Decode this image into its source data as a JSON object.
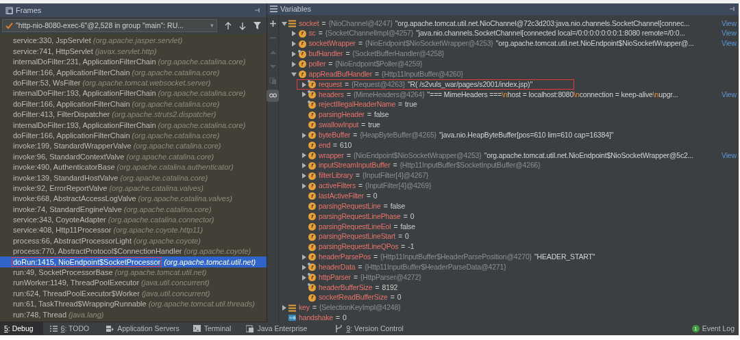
{
  "frames_panel": {
    "title": "Frames",
    "thread_selector": {
      "value": "\"http-nio-8080-exec-6\"@2,528 in group \"main\": RU...",
      "caret": "▾"
    },
    "frames": [
      {
        "method": "service:330, JspServlet",
        "package": "(org.apache.jasper.servlet)",
        "selected": false,
        "boxed": false
      },
      {
        "method": "service:741, HttpServlet",
        "package": "(javax.servlet.http)",
        "selected": false,
        "boxed": false
      },
      {
        "method": "internalDoFilter:231, ApplicationFilterChain",
        "package": "(org.apache.catalina.core)",
        "selected": false,
        "boxed": false
      },
      {
        "method": "doFilter:166, ApplicationFilterChain",
        "package": "(org.apache.catalina.core)",
        "selected": false,
        "boxed": false
      },
      {
        "method": "doFilter:53, WsFilter",
        "package": "(org.apache.tomcat.websocket.server)",
        "selected": false,
        "boxed": false
      },
      {
        "method": "internalDoFilter:193, ApplicationFilterChain",
        "package": "(org.apache.catalina.core)",
        "selected": false,
        "boxed": false
      },
      {
        "method": "doFilter:166, ApplicationFilterChain",
        "package": "(org.apache.catalina.core)",
        "selected": false,
        "boxed": false
      },
      {
        "method": "doFilter:413, FilterDispatcher",
        "package": "(org.apache.struts2.dispatcher)",
        "selected": false,
        "boxed": false
      },
      {
        "method": "internalDoFilter:193, ApplicationFilterChain",
        "package": "(org.apache.catalina.core)",
        "selected": false,
        "boxed": false
      },
      {
        "method": "doFilter:166, ApplicationFilterChain",
        "package": "(org.apache.catalina.core)",
        "selected": false,
        "boxed": false
      },
      {
        "method": "invoke:199, StandardWrapperValve",
        "package": "(org.apache.catalina.core)",
        "selected": false,
        "boxed": false
      },
      {
        "method": "invoke:96, StandardContextValve",
        "package": "(org.apache.catalina.core)",
        "selected": false,
        "boxed": false
      },
      {
        "method": "invoke:490, AuthenticatorBase",
        "package": "(org.apache.catalina.authenticator)",
        "selected": false,
        "boxed": false
      },
      {
        "method": "invoke:139, StandardHostValve",
        "package": "(org.apache.catalina.core)",
        "selected": false,
        "boxed": false
      },
      {
        "method": "invoke:92, ErrorReportValve",
        "package": "(org.apache.catalina.valves)",
        "selected": false,
        "boxed": false
      },
      {
        "method": "invoke:668, AbstractAccessLogValve",
        "package": "(org.apache.catalina.valves)",
        "selected": false,
        "boxed": false
      },
      {
        "method": "invoke:74, StandardEngineValve",
        "package": "(org.apache.catalina.core)",
        "selected": false,
        "boxed": false
      },
      {
        "method": "service:343, CoyoteAdapter",
        "package": "(org.apache.catalina.connector)",
        "selected": false,
        "boxed": false
      },
      {
        "method": "service:408, Http11Processor",
        "package": "(org.apache.coyote.http11)",
        "selected": false,
        "boxed": false
      },
      {
        "method": "process:66, AbstractProcessorLight",
        "package": "(org.apache.coyote)",
        "selected": false,
        "boxed": false
      },
      {
        "method": "process:770, AbstractProtocol$ConnectionHandler",
        "package": "(org.apache.coyote)",
        "selected": false,
        "boxed": false
      },
      {
        "method": "doRun:1415, NioEndpoint$SocketProcessor",
        "package": "(org.apache.tomcat.util.net)",
        "selected": true,
        "boxed": true
      },
      {
        "method": "run:49, SocketProcessorBase",
        "package": "(org.apache.tomcat.util.net)",
        "selected": false,
        "boxed": false
      },
      {
        "method": "runWorker:1149, ThreadPoolExecutor",
        "package": "(java.util.concurrent)",
        "selected": false,
        "boxed": false
      },
      {
        "method": "run:624, ThreadPoolExecutor$Worker",
        "package": "(java.util.concurrent)",
        "selected": false,
        "boxed": false
      },
      {
        "method": "run:61, TaskThread$WrappingRunnable",
        "package": "(org.apache.tomcat.util.threads)",
        "selected": false,
        "boxed": false
      },
      {
        "method": "run:748, Thread",
        "package": "(java.lang)",
        "selected": false,
        "boxed": false
      }
    ]
  },
  "variables_panel": {
    "title": "Variables",
    "toolbar": [
      {
        "kind": "add",
        "disabled": false,
        "selected": false
      },
      {
        "kind": "remove",
        "disabled": true,
        "selected": false
      },
      {
        "kind": "up",
        "disabled": true,
        "selected": false
      },
      {
        "kind": "down",
        "disabled": true,
        "selected": false
      },
      {
        "kind": "copy",
        "disabled": true,
        "selected": false
      },
      {
        "kind": "watches",
        "disabled": false,
        "selected": true
      }
    ],
    "tree": [
      {
        "kind": "object",
        "name": "socket",
        "expanded": true,
        "value": [
          {
            "kind": "plain",
            "text": "="
          },
          {
            "kind": "type",
            "text": "{NioChannel@4247}"
          },
          {
            "kind": "string",
            "text": "\"org.apache.tomcat.util.net.NioChannel@72c3d203:java.nio.channels.SocketChannel[connec..."
          }
        ],
        "link": "View",
        "children": [
          {
            "kind": "field",
            "icon": "f",
            "marker": false,
            "name": "sc",
            "expanded": false,
            "value": [
              {
                "kind": "plain",
                "text": "="
              },
              {
                "kind": "type",
                "text": "{SocketChannelImpl@4257}"
              },
              {
                "kind": "string",
                "text": "\"java.nio.channels.SocketChannel[connected local=/0:0:0:0:0:0:0:1:8080 remote=/0:0..."
              }
            ],
            "link": "View"
          },
          {
            "kind": "field",
            "icon": "f",
            "marker": false,
            "name": "socketWrapper",
            "expanded": false,
            "value": [
              {
                "kind": "plain",
                "text": "="
              },
              {
                "kind": "type",
                "text": "{NioEndpoint$NioSocketWrapper@4253}"
              },
              {
                "kind": "string",
                "text": "\"org.apache.tomcat.util.net.NioEndpoint$NioSocketWrapper@..."
              }
            ],
            "link": "View"
          },
          {
            "kind": "field",
            "icon": "f",
            "marker": true,
            "name": "bufHandler",
            "expanded": false,
            "value": [
              {
                "kind": "plain",
                "text": "="
              },
              {
                "kind": "type",
                "text": "{SocketBufferHandler@4258}"
              }
            ]
          },
          {
            "kind": "field",
            "icon": "f",
            "marker": false,
            "name": "poller",
            "expanded": false,
            "value": [
              {
                "kind": "plain",
                "text": "="
              },
              {
                "kind": "type",
                "text": "{NioEndpoint$Poller@4259}"
              }
            ]
          },
          {
            "kind": "field",
            "icon": "f",
            "marker": false,
            "name": "appReadBufHandler",
            "expanded": true,
            "value": [
              {
                "kind": "plain",
                "text": "="
              },
              {
                "kind": "type",
                "text": "{Http11InputBuffer@4260}"
              }
            ],
            "children": [
              {
                "kind": "field",
                "icon": "f",
                "marker": true,
                "name": "request",
                "expanded": false,
                "boxed": true,
                "value": [
                  {
                    "kind": "plain",
                    "text": "="
                  },
                  {
                    "kind": "type",
                    "text": "{Request@4263}"
                  },
                  {
                    "kind": "string",
                    "text": "\"R( /s2vuls_war/pages/s2001/index.jsp)\""
                  }
                ]
              },
              {
                "kind": "field",
                "icon": "f",
                "marker": true,
                "name": "headers",
                "expanded": false,
                "value": [
                  {
                    "kind": "plain",
                    "text": "="
                  },
                  {
                    "kind": "type",
                    "text": "{MimeHeaders@4264}"
                  },
                  {
                    "kind": "string",
                    "text": "\"=== MimeHeaders ==="
                  },
                  {
                    "kind": "escape",
                    "text": "\\n"
                  },
                  {
                    "kind": "string",
                    "text": "host = localhost:8080"
                  },
                  {
                    "kind": "escape",
                    "text": "\\n"
                  },
                  {
                    "kind": "string",
                    "text": "connection = keep-alive"
                  },
                  {
                    "kind": "escape",
                    "text": "\\n"
                  },
                  {
                    "kind": "string",
                    "text": "upgr..."
                  }
                ],
                "link": "View"
              },
              {
                "kind": "field",
                "icon": "f",
                "marker": true,
                "name": "rejectIllegalHeaderName",
                "value": [
                  {
                    "kind": "plain",
                    "text": "="
                  },
                  {
                    "kind": "plain",
                    "text": "true"
                  }
                ]
              },
              {
                "kind": "field",
                "icon": "f",
                "marker": false,
                "name": "parsingHeader",
                "value": [
                  {
                    "kind": "plain",
                    "text": "="
                  },
                  {
                    "kind": "plain",
                    "text": "false"
                  }
                ]
              },
              {
                "kind": "field",
                "icon": "f",
                "marker": false,
                "name": "swallowInput",
                "value": [
                  {
                    "kind": "plain",
                    "text": "="
                  },
                  {
                    "kind": "plain",
                    "text": "true"
                  }
                ]
              },
              {
                "kind": "field",
                "icon": "f",
                "marker": false,
                "name": "byteBuffer",
                "expanded": false,
                "value": [
                  {
                    "kind": "plain",
                    "text": "="
                  },
                  {
                    "kind": "type",
                    "text": "{HeapByteBuffer@4265}"
                  },
                  {
                    "kind": "string",
                    "text": "\"java.nio.HeapByteBuffer[pos=610 lim=610 cap=16384]\""
                  }
                ]
              },
              {
                "kind": "field",
                "icon": "f",
                "marker": false,
                "name": "end",
                "value": [
                  {
                    "kind": "plain",
                    "text": "="
                  },
                  {
                    "kind": "plain",
                    "text": "610"
                  }
                ]
              },
              {
                "kind": "field",
                "icon": "f",
                "marker": false,
                "name": "wrapper",
                "expanded": false,
                "value": [
                  {
                    "kind": "plain",
                    "text": "="
                  },
                  {
                    "kind": "type",
                    "text": "{NioEndpoint$NioSocketWrapper@4253}"
                  },
                  {
                    "kind": "string",
                    "text": "\"org.apache.tomcat.util.net.NioEndpoint$NioSocketWrapper@5c2..."
                  }
                ],
                "link": "View"
              },
              {
                "kind": "field",
                "icon": "f",
                "marker": false,
                "name": "inputStreamInputBuffer",
                "expanded": false,
                "value": [
                  {
                    "kind": "plain",
                    "text": "="
                  },
                  {
                    "kind": "type",
                    "text": "{Http11InputBuffer$SocketInputBuffer@4266}"
                  }
                ]
              },
              {
                "kind": "field",
                "icon": "f",
                "marker": false,
                "name": "filterLibrary",
                "expanded": false,
                "value": [
                  {
                    "kind": "plain",
                    "text": "="
                  },
                  {
                    "kind": "type",
                    "text": "{InputFilter[4]@4267}"
                  }
                ]
              },
              {
                "kind": "field",
                "icon": "f",
                "marker": false,
                "name": "activeFilters",
                "expanded": false,
                "value": [
                  {
                    "kind": "plain",
                    "text": "="
                  },
                  {
                    "kind": "type",
                    "text": "{InputFilter[4]@4269}"
                  }
                ]
              },
              {
                "kind": "field",
                "icon": "f",
                "marker": false,
                "name": "lastActiveFilter",
                "value": [
                  {
                    "kind": "plain",
                    "text": "="
                  },
                  {
                    "kind": "plain",
                    "text": "0"
                  }
                ]
              },
              {
                "kind": "field",
                "icon": "f",
                "marker": false,
                "name": "parsingRequestLine",
                "value": [
                  {
                    "kind": "plain",
                    "text": "="
                  },
                  {
                    "kind": "plain",
                    "text": "false"
                  }
                ]
              },
              {
                "kind": "field",
                "icon": "f",
                "marker": false,
                "name": "parsingRequestLinePhase",
                "value": [
                  {
                    "kind": "plain",
                    "text": "="
                  },
                  {
                    "kind": "plain",
                    "text": "0"
                  }
                ]
              },
              {
                "kind": "field",
                "icon": "f",
                "marker": false,
                "name": "parsingRequestLineEol",
                "value": [
                  {
                    "kind": "plain",
                    "text": "="
                  },
                  {
                    "kind": "plain",
                    "text": "false"
                  }
                ]
              },
              {
                "kind": "field",
                "icon": "f",
                "marker": false,
                "name": "parsingRequestLineStart",
                "value": [
                  {
                    "kind": "plain",
                    "text": "="
                  },
                  {
                    "kind": "plain",
                    "text": "0"
                  }
                ]
              },
              {
                "kind": "field",
                "icon": "f",
                "marker": false,
                "name": "parsingRequestLineQPos",
                "value": [
                  {
                    "kind": "plain",
                    "text": "="
                  },
                  {
                    "kind": "plain",
                    "text": "-1"
                  }
                ]
              },
              {
                "kind": "field",
                "icon": "f",
                "marker": false,
                "name": "headerParsePos",
                "expanded": false,
                "value": [
                  {
                    "kind": "plain",
                    "text": "="
                  },
                  {
                    "kind": "type",
                    "text": "{Http11InputBuffer$HeaderParsePosition@4270}"
                  },
                  {
                    "kind": "string",
                    "text": "\"HEADER_START\""
                  }
                ]
              },
              {
                "kind": "field",
                "icon": "f",
                "marker": true,
                "name": "headerData",
                "expanded": false,
                "value": [
                  {
                    "kind": "plain",
                    "text": "="
                  },
                  {
                    "kind": "type",
                    "text": "{Http11InputBuffer$HeaderParseData@4271}"
                  }
                ]
              },
              {
                "kind": "field",
                "icon": "f",
                "marker": true,
                "name": "httpParser",
                "expanded": false,
                "value": [
                  {
                    "kind": "plain",
                    "text": "="
                  },
                  {
                    "kind": "type",
                    "text": "{HttpParser@4272}"
                  }
                ]
              },
              {
                "kind": "field",
                "icon": "f",
                "marker": true,
                "name": "headerBufferSize",
                "value": [
                  {
                    "kind": "plain",
                    "text": "="
                  },
                  {
                    "kind": "plain",
                    "text": "8192"
                  }
                ]
              },
              {
                "kind": "field",
                "icon": "f",
                "marker": false,
                "name": "socketReadBufferSize",
                "value": [
                  {
                    "kind": "plain",
                    "text": "="
                  },
                  {
                    "kind": "plain",
                    "text": "0"
                  }
                ]
              }
            ]
          }
        ]
      },
      {
        "kind": "object",
        "name": "key",
        "expanded": false,
        "value": [
          {
            "kind": "plain",
            "text": "="
          },
          {
            "kind": "type",
            "text": "{SelectionKeyImpl@4248}"
          }
        ]
      },
      {
        "kind": "primitive",
        "name": "handshake",
        "value": [
          {
            "kind": "plain",
            "text": "="
          },
          {
            "kind": "plain",
            "text": "0"
          }
        ]
      }
    ]
  },
  "bottom_bar": {
    "tabs": [
      {
        "kind": "debug",
        "mnemonic": "5",
        "label": ": Debug",
        "selected": true
      },
      {
        "kind": "todo",
        "mnemonic": "6",
        "label": ": TODO",
        "selected": false
      },
      {
        "kind": "servers",
        "label": "Application Servers",
        "selected": false
      },
      {
        "kind": "terminal",
        "label": "Terminal",
        "selected": false
      },
      {
        "kind": "enterprise",
        "label": "Java Enterprise",
        "selected": false
      },
      {
        "kind": "vcs",
        "mnemonic": "9",
        "label": ": Version Control",
        "selected": false
      }
    ],
    "event_log": {
      "count": "1",
      "label": "Event Log"
    }
  }
}
